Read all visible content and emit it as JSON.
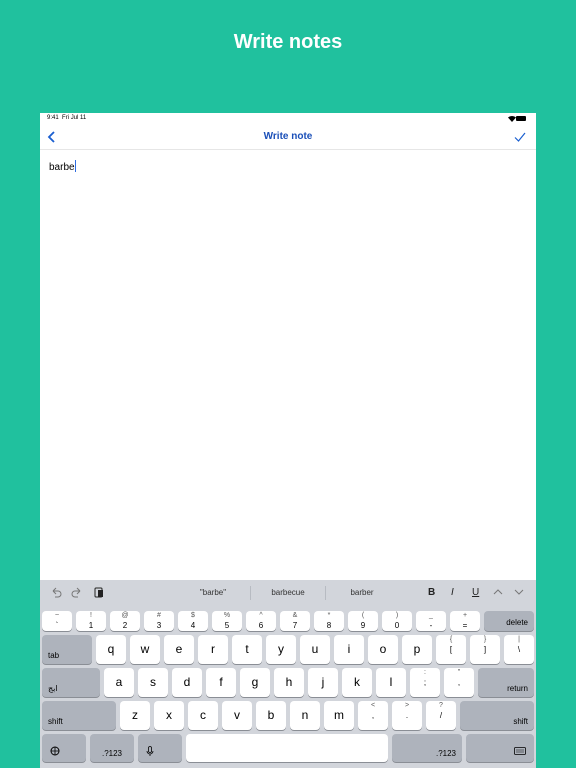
{
  "promo": {
    "title": "Write notes"
  },
  "status": {
    "time": "9:41",
    "date": "Fri Jul 11"
  },
  "nav": {
    "title": "Write note"
  },
  "editor": {
    "text": "barbe"
  },
  "suggestions": {
    "words": [
      "\"barbe\"",
      "barbecue",
      "barber"
    ],
    "bold": "B",
    "italic": "I",
    "underline": "U"
  },
  "keyboard": {
    "row1": [
      {
        "t": "~",
        "b": "`"
      },
      {
        "t": "!",
        "b": "1"
      },
      {
        "t": "@",
        "b": "2"
      },
      {
        "t": "#",
        "b": "3"
      },
      {
        "t": "$",
        "b": "4"
      },
      {
        "t": "%",
        "b": "5"
      },
      {
        "t": "^",
        "b": "6"
      },
      {
        "t": "&",
        "b": "7"
      },
      {
        "t": "*",
        "b": "8"
      },
      {
        "t": "(",
        "b": "9"
      },
      {
        "t": ")",
        "b": "0"
      },
      {
        "t": "_",
        "b": "-"
      },
      {
        "t": "+",
        "b": "="
      }
    ],
    "delete": "delete",
    "tab": "tab",
    "row2": [
      "q",
      "w",
      "e",
      "r",
      "t",
      "y",
      "u",
      "i",
      "o",
      "p"
    ],
    "row2extra": [
      {
        "t": "{",
        "b": "["
      },
      {
        "t": "}",
        "b": "]"
      },
      {
        "t": "|",
        "b": "\\"
      }
    ],
    "lang": "ابج",
    "row3": [
      "a",
      "s",
      "d",
      "f",
      "g",
      "h",
      "j",
      "k",
      "l"
    ],
    "row3extra": [
      {
        "t": ":",
        "b": ";"
      },
      {
        "t": "\"",
        "b": ","
      }
    ],
    "return": "return",
    "shift": "shift",
    "row4": [
      "z",
      "x",
      "c",
      "v",
      "b",
      "n",
      "m"
    ],
    "row4extra": [
      {
        "t": "<",
        "b": ","
      },
      {
        "t": ">",
        "b": "."
      },
      {
        "t": "?",
        "b": "/"
      }
    ],
    "numbers": ".?123"
  }
}
